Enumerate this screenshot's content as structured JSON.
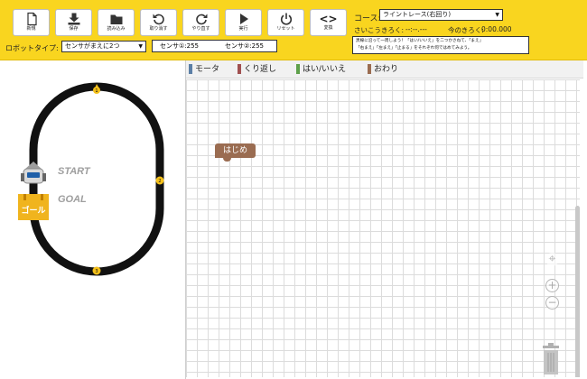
{
  "toolbar": {
    "new_label": "新規",
    "save_label": "保存",
    "load_label": "読み込み",
    "undo_label": "取り消す",
    "redo_label": "やり直す",
    "run_label": "実行",
    "reset_label": "リセット",
    "convert_label": "変換",
    "convert_glyph": "<>"
  },
  "robot": {
    "label": "ロボットタイプ:",
    "type_value": "センサがまえに2つ"
  },
  "sensors": {
    "sensor1": "センサ①:255",
    "sensor2": "センサ②:255"
  },
  "course": {
    "label": "コース:",
    "value": "ライントレース(右回り)"
  },
  "records": {
    "best_label": "さいこうきろく:",
    "best_value": "--:--.---",
    "current_label": "今のきろく:",
    "current_value": "0:00.000"
  },
  "mission": {
    "line1": "黒線に沿って一周しよう！「はい/いいえ」を二つかさねて、「まえ」",
    "line2": "「右まえ」「左まえ」「止まる」をそれぞれ何ではめてみよう。"
  },
  "stage": {
    "start_label": "START",
    "goal_label": "GOAL",
    "goal_sign": "ゴール",
    "checkpoints": [
      "1",
      "2",
      "3",
      "4"
    ]
  },
  "palette": {
    "tabs": [
      {
        "label": "モータ",
        "color": "#5b7fa6"
      },
      {
        "label": "くり返し",
        "color": "#a05050"
      },
      {
        "label": "はい/いいえ",
        "color": "#5ea04a"
      },
      {
        "label": "おわり",
        "color": "#9a6c51"
      }
    ]
  },
  "workspace": {
    "start_block": "はじめ"
  },
  "colors": {
    "header_bg": "#f9d51f",
    "track": "#111111",
    "checkpoint": "#f4c01a",
    "goal_sign": "#f0b41e"
  },
  "icons": {
    "new": "new-file-icon",
    "save": "download-icon",
    "load": "folder-icon",
    "undo": "undo-icon",
    "redo": "redo-icon",
    "run": "play-icon",
    "reset": "power-icon",
    "convert": "code-icon",
    "locate": "crosshair-icon",
    "zoom_in": "zoom-in-icon",
    "zoom_out": "zoom-out-icon",
    "trash": "trash-icon"
  }
}
